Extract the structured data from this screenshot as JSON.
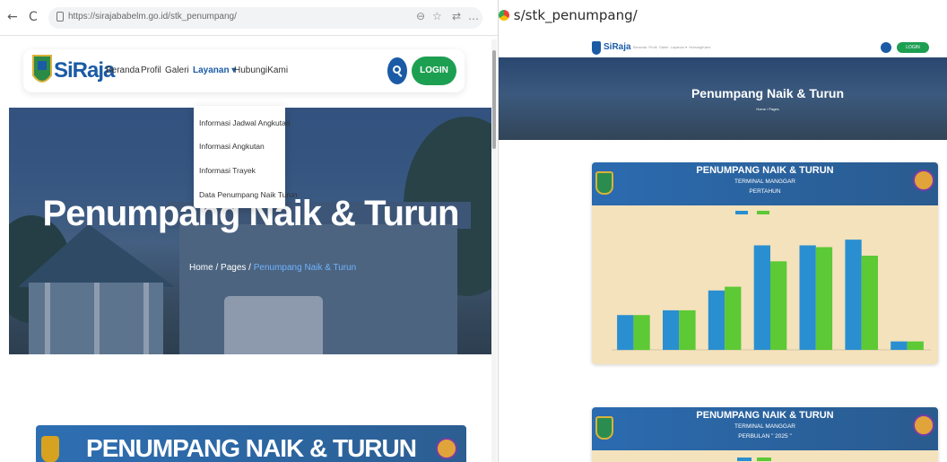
{
  "browser": {
    "back": "←",
    "reload": "C",
    "url": "https://sirajababelm.go.id/stk_penumpang/",
    "icon_a": "⊖",
    "icon_b": "☆",
    "icon_c": "⇄",
    "icon_d": "…"
  },
  "site": {
    "logo": "SiRaja",
    "nav": [
      {
        "label": "Beranda"
      },
      {
        "label": "Profil"
      },
      {
        "label": "Galeri"
      },
      {
        "label": "Layanan ▾"
      },
      {
        "label": "HubungiKami"
      }
    ],
    "login_label": "LOGIN",
    "dropdown": [
      {
        "label": "Informasi Jadwal Angkutan"
      },
      {
        "label": "Informasi Angkutan"
      },
      {
        "label": "Informasi Trayek"
      },
      {
        "label": "Data Penumpang Naik Turun"
      }
    ],
    "hero_title": "Penumpang Naik & Turun",
    "crumbs": {
      "home": "Home",
      "sep1": " / ",
      "pages": "Pages",
      "sep2": " / ",
      "current": "Penumpang Naik & Turun"
    },
    "section_title": "PENUMPANG NAIK & TURUN"
  },
  "right": {
    "url": "s/stk_penumpang/",
    "logo": "SiRaja",
    "hero_title": "Penumpang Naik & Turun",
    "crumbs": "Home / Pages",
    "card1": {
      "title": "PENUMPANG NAIK & TURUN",
      "sub1": "TERMINAL MANGGAR",
      "sub2": "PERTAHUN"
    },
    "card2": {
      "title": "PENUMPANG NAIK & TURUN",
      "sub1": "TERMINAL MANGGAR",
      "sub2": "PERBULAN \" 2025 \""
    }
  },
  "colors": {
    "naik": "#2a8fd0",
    "turun": "#5cc935",
    "brand_blue": "#1b5ba6",
    "brand_green": "#1d9f52"
  },
  "chart_data": {
    "type": "bar",
    "title": "PENUMPANG NAIK & TURUN",
    "categories": [
      "",
      "",
      "",
      "",
      "",
      "",
      ""
    ],
    "series": [
      {
        "name": "",
        "values": [
          370,
          420,
          630,
          1110,
          1110,
          1170,
          90
        ]
      },
      {
        "name": "",
        "values": [
          370,
          420,
          670,
          940,
          1090,
          1000,
          90
        ]
      }
    ],
    "ylim": [
      0,
      1400
    ],
    "grid": false,
    "legend": "top-center"
  }
}
